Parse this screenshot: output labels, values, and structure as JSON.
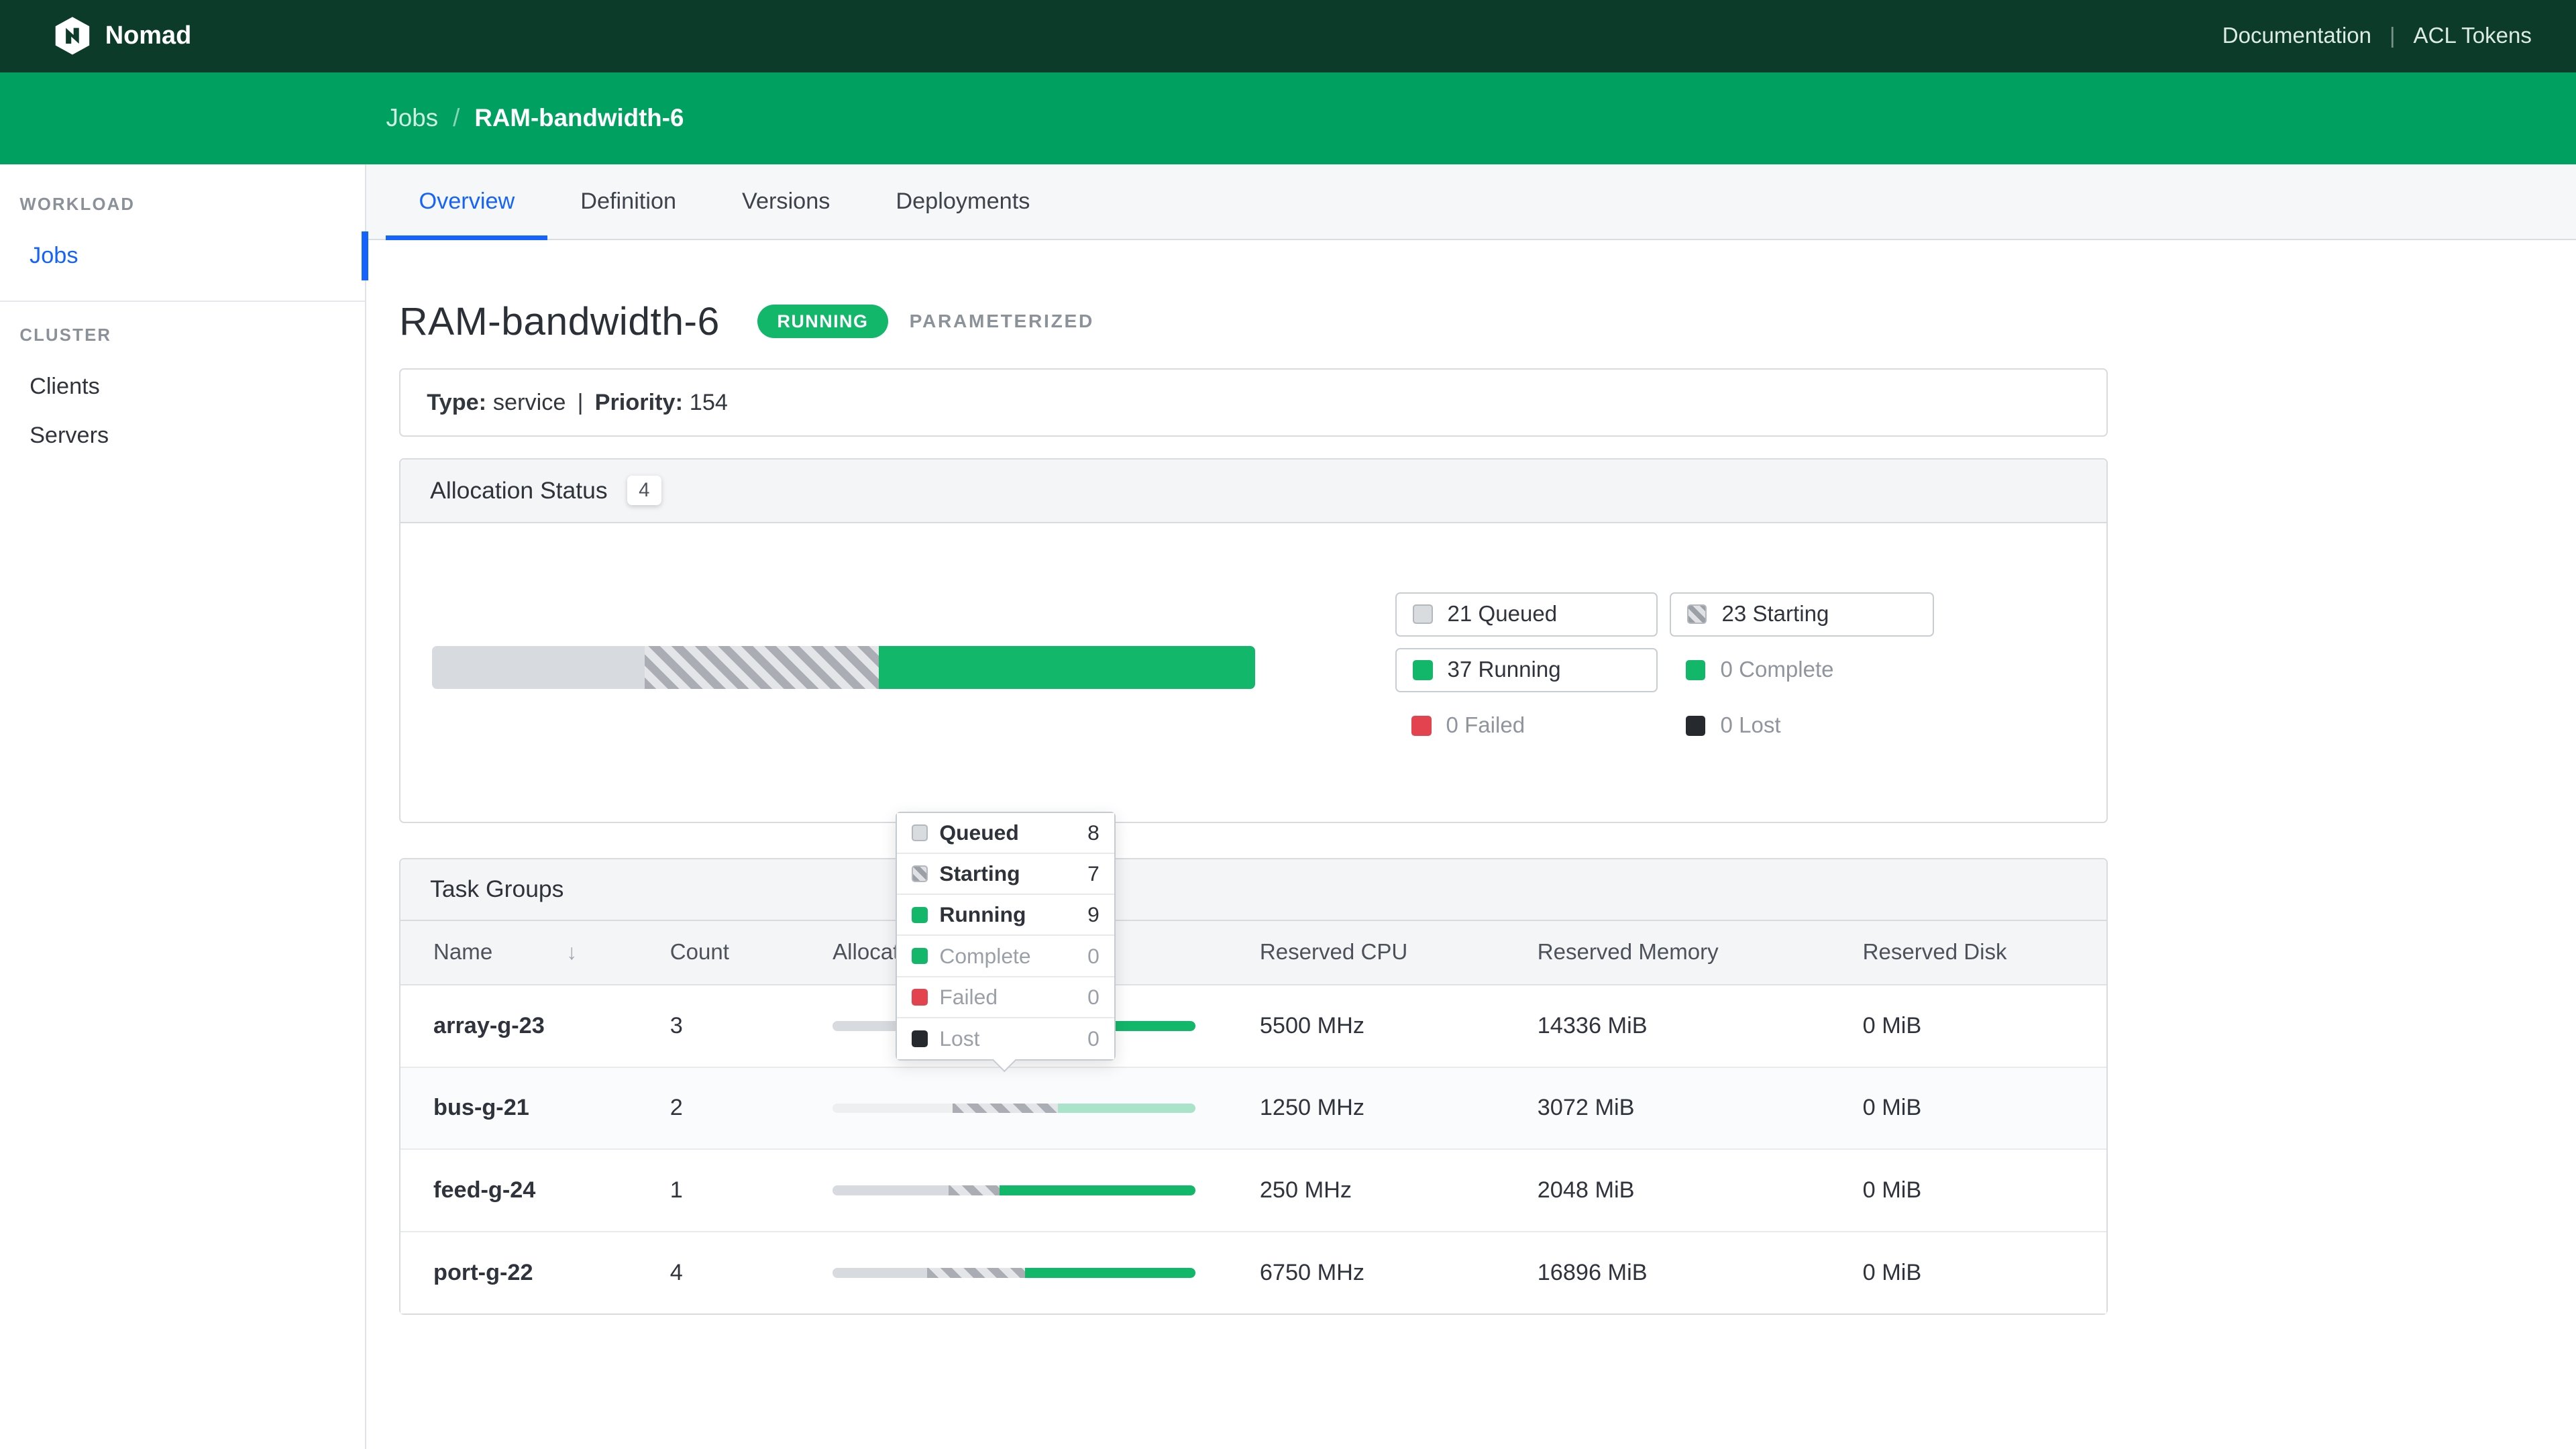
{
  "colors": {
    "topnav_bg": "#0c3b2a",
    "breadcrumb_bg": "#00a160",
    "accent_blue": "#1563ff",
    "running_green": "#12b76a",
    "failed_red": "#e2434e",
    "lost_black": "#26292e",
    "queued_gray": "#d9dcdf"
  },
  "topnav": {
    "brand": "Nomad",
    "doc_link": "Documentation",
    "separator": "|",
    "acl_link": "ACL Tokens"
  },
  "breadcrumb": {
    "parent": "Jobs",
    "separator": "/",
    "current": "RAM-bandwidth-6"
  },
  "sidebar": {
    "workload_heading": "WORKLOAD",
    "jobs": "Jobs",
    "cluster_heading": "CLUSTER",
    "clients": "Clients",
    "servers": "Servers"
  },
  "tabs": [
    {
      "label": "Overview",
      "active": true
    },
    {
      "label": "Definition",
      "active": false
    },
    {
      "label": "Versions",
      "active": false
    },
    {
      "label": "Deployments",
      "active": false
    }
  ],
  "job": {
    "title": "RAM-bandwidth-6",
    "status_badge": "RUNNING",
    "parameterized_tag": "PARAMETERIZED",
    "type_label": "Type:",
    "type_value": "service",
    "meta_separator": "|",
    "priority_label": "Priority:",
    "priority_value": "154"
  },
  "allocation_status": {
    "title": "Allocation Status",
    "badge": "4",
    "legend": [
      {
        "count": "21",
        "label": "Queued"
      },
      {
        "count": "23",
        "label": "Starting"
      },
      {
        "count": "37",
        "label": "Running"
      },
      {
        "count": "0",
        "label": "Complete"
      },
      {
        "count": "0",
        "label": "Failed"
      },
      {
        "count": "0",
        "label": "Lost"
      }
    ],
    "bar_pct": {
      "queued": 25.9,
      "starting": 28.4,
      "running": 45.7
    }
  },
  "chart_data": {
    "type": "bar",
    "title": "Allocation Status",
    "categories": [
      "Queued",
      "Starting",
      "Running",
      "Complete",
      "Failed",
      "Lost"
    ],
    "values": [
      21,
      23,
      37,
      0,
      0,
      0
    ]
  },
  "task_groups": {
    "title": "Task Groups",
    "columns": [
      "Name",
      "Count",
      "Allocation Status",
      "Reserved CPU",
      "Reserved Memory",
      "Reserved Disk"
    ],
    "rows": [
      {
        "name": "array-g-23",
        "count": "3",
        "cpu": "5500 MHz",
        "memory": "14336 MiB",
        "disk": "0 MiB",
        "bar_pct": {
          "queued": 34,
          "starting": 21,
          "running": 45
        }
      },
      {
        "name": "bus-g-21",
        "count": "2",
        "cpu": "1250 MHz",
        "memory": "3072 MiB",
        "disk": "0 MiB",
        "bar_pct": {
          "queued": 33,
          "starting": 29,
          "running": 38
        }
      },
      {
        "name": "feed-g-24",
        "count": "1",
        "cpu": "250 MHz",
        "memory": "2048 MiB",
        "disk": "0 MiB",
        "bar_pct": {
          "queued": 32,
          "starting": 14,
          "running": 54
        }
      },
      {
        "name": "port-g-22",
        "count": "4",
        "cpu": "6750 MHz",
        "memory": "16896 MiB",
        "disk": "0 MiB",
        "bar_pct": {
          "queued": 26,
          "starting": 27,
          "running": 47
        }
      }
    ]
  },
  "tooltip": {
    "rows": [
      {
        "label": "Queued",
        "value": "8"
      },
      {
        "label": "Starting",
        "value": "7"
      },
      {
        "label": "Running",
        "value": "9"
      },
      {
        "label": "Complete",
        "value": "0"
      },
      {
        "label": "Failed",
        "value": "0"
      },
      {
        "label": "Lost",
        "value": "0"
      }
    ]
  }
}
